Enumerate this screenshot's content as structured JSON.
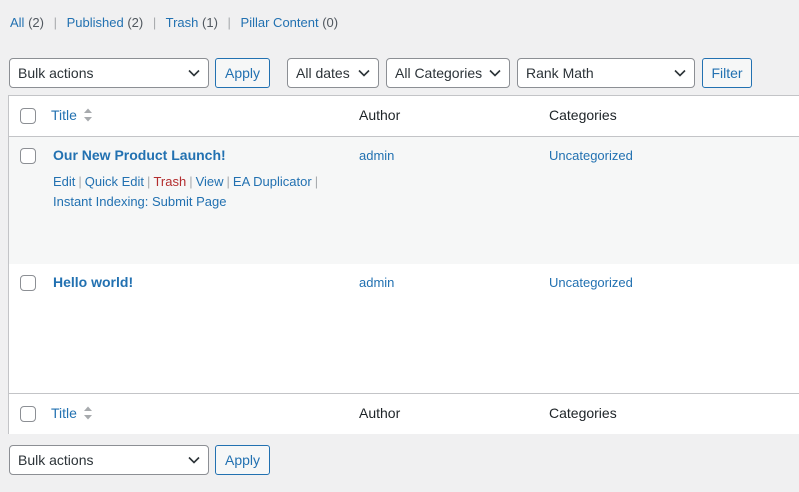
{
  "views": [
    {
      "label": "All",
      "count": "(2)"
    },
    {
      "label": "Published",
      "count": "(2)"
    },
    {
      "label": "Trash",
      "count": "(1)"
    },
    {
      "label": "Pillar Content",
      "count": "(0)"
    }
  ],
  "toolbar_top": {
    "bulk_actions": "Bulk actions",
    "apply": "Apply",
    "dates": "All dates",
    "categories": "All Categories",
    "rank_math": "Rank Math",
    "filter": "Filter"
  },
  "toolbar_bottom": {
    "bulk_actions": "Bulk actions",
    "apply": "Apply"
  },
  "columns": {
    "title": "Title",
    "author": "Author",
    "categories": "Categories"
  },
  "rows": [
    {
      "title": "Our New Product Launch!",
      "author": "admin",
      "category": "Uncategorized",
      "actions": {
        "edit": "Edit",
        "quick_edit": "Quick Edit",
        "trash": "Trash",
        "view": "View",
        "duplicator": "EA Duplicator",
        "indexing": "Instant Indexing: Submit Page"
      }
    },
    {
      "title": "Hello world!",
      "author": "admin",
      "category": "Uncategorized"
    }
  ],
  "colors": {
    "link": "#2271b1",
    "trash": "#b32d2e",
    "background": "#f0f0f1"
  }
}
